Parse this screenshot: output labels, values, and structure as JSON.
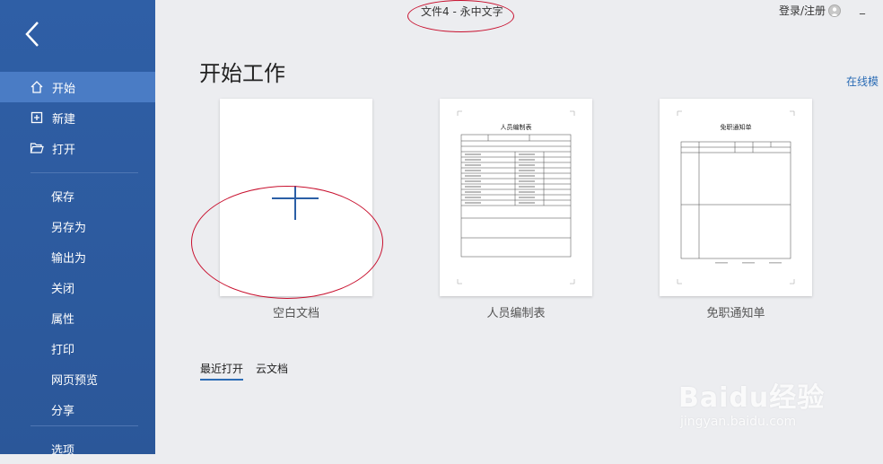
{
  "window": {
    "title": "文件4 - 永中文字",
    "login_label": "登录/注册",
    "minimize_glyph": "_"
  },
  "sidebar": {
    "items": [
      {
        "label": "开始",
        "icon": "home-icon"
      },
      {
        "label": "新建",
        "icon": "new-file-icon"
      },
      {
        "label": "打开",
        "icon": "folder-open-icon"
      }
    ],
    "sub_items": [
      {
        "label": "保存"
      },
      {
        "label": "另存为"
      },
      {
        "label": "输出为"
      },
      {
        "label": "关闭"
      },
      {
        "label": "属性"
      },
      {
        "label": "打印"
      },
      {
        "label": "网页预览"
      },
      {
        "label": "分享"
      },
      {
        "label": "选项"
      }
    ]
  },
  "main": {
    "heading": "开始工作",
    "online_templates": "在线模",
    "templates": [
      {
        "label": "空白文档"
      },
      {
        "label": "人员编制表",
        "doc_title": "人员编制表"
      },
      {
        "label": "免职通知单",
        "doc_title": "免职通知单"
      }
    ],
    "tabs": [
      {
        "label": "最近打开",
        "active": true
      },
      {
        "label": "云文档",
        "active": false
      }
    ]
  },
  "watermark": {
    "brand": "Baidu经验",
    "url": "jingyan.baidu.com"
  },
  "colors": {
    "sidebar": "#2b5799",
    "sidebar_active": "#4a7cc5",
    "accent": "#2b6cb5",
    "annotation": "#c8102e"
  }
}
